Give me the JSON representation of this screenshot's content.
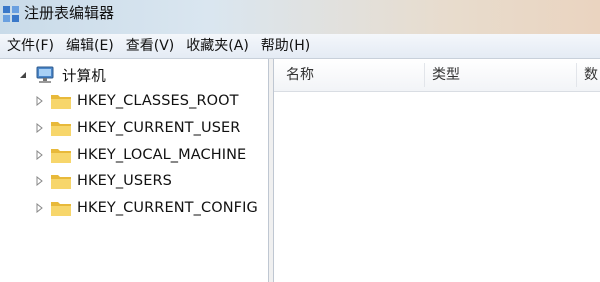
{
  "window": {
    "title": "注册表编辑器"
  },
  "menu": [
    "文件(F)",
    "编辑(E)",
    "查看(V)",
    "收藏夹(A)",
    "帮助(H)"
  ],
  "tree": {
    "root": {
      "label": "计算机",
      "icon": "computer-icon",
      "expanded": true
    },
    "keys": [
      {
        "label": "HKEY_CLASSES_ROOT",
        "icon": "folder-icon"
      },
      {
        "label": "HKEY_CURRENT_USER",
        "icon": "folder-icon"
      },
      {
        "label": "HKEY_LOCAL_MACHINE",
        "icon": "folder-icon"
      },
      {
        "label": "HKEY_USERS",
        "icon": "folder-icon"
      },
      {
        "label": "HKEY_CURRENT_CONFIG",
        "icon": "folder-icon"
      }
    ]
  },
  "list": {
    "columns": [
      "名称",
      "类型",
      "数"
    ]
  },
  "colors": {
    "folder": "#f2c94c",
    "titlebar_left": "#c9dbe9",
    "titlebar_right": "#ead4c0",
    "menubar": "#e4ebf4"
  }
}
